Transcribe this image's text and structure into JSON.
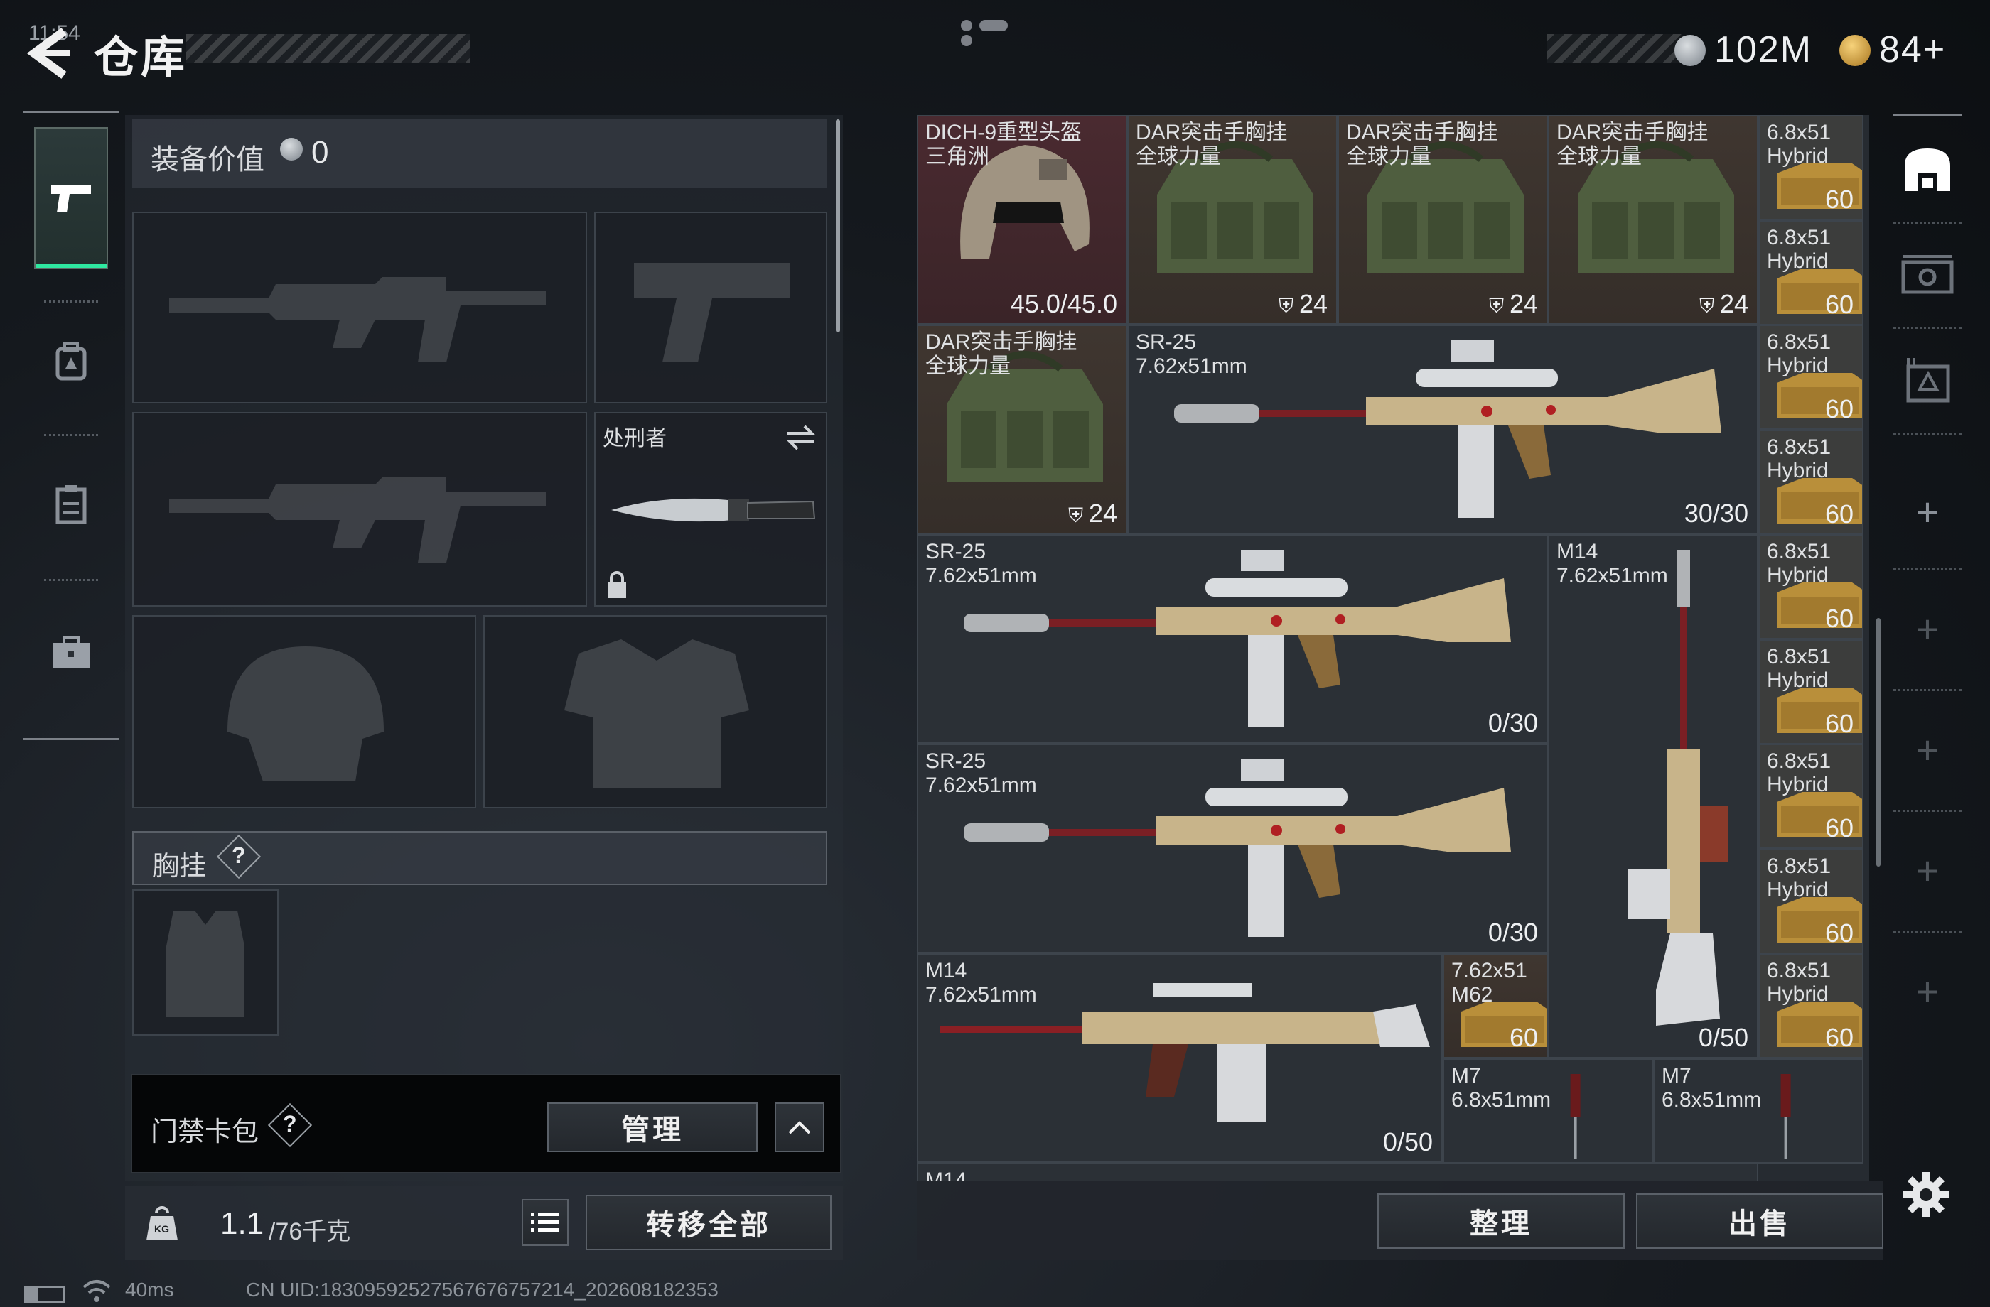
{
  "header": {
    "time": "11:54",
    "title": "仓库",
    "currency_1": {
      "icon": "coin-icon",
      "value": "102M"
    },
    "currency_2": {
      "icon": "medal-icon",
      "value": "84+"
    }
  },
  "left_rail": {
    "items": [
      {
        "icon": "pistol-icon",
        "active": true
      },
      {
        "icon": "backpack-icon",
        "active": false
      },
      {
        "icon": "clipboard-icon",
        "active": false
      },
      {
        "icon": "briefcase-icon",
        "active": false
      }
    ]
  },
  "equipment": {
    "value_label": "装备价值",
    "value": "0",
    "melee_name": "处刑者",
    "chest_label": "胸挂",
    "help": "?",
    "keycard_label": "门禁卡包",
    "manage_label": "管理",
    "weight_current": "1.1",
    "weight_max": "/76千克",
    "transfer_all_label": "转移全部",
    "weight_icon_text": "KG"
  },
  "inventory": {
    "cells": [
      {
        "id": "helmet",
        "name": "DICH-9重型头盔\n三角洲",
        "count": "45.0/45.0",
        "style": "red",
        "art": "helmet"
      },
      {
        "id": "rig1",
        "name": "DAR突击手胸挂\n全球力量",
        "count": "24",
        "style": "brown",
        "art": "rig",
        "count_icon": true
      },
      {
        "id": "rig2",
        "name": "DAR突击手胸挂\n全球力量",
        "count": "24",
        "style": "brown",
        "art": "rig",
        "count_icon": true
      },
      {
        "id": "rig3",
        "name": "DAR突击手胸挂\n全球力量",
        "count": "24",
        "style": "brown",
        "art": "rig",
        "count_icon": true
      },
      {
        "id": "rig4",
        "name": "DAR突击手胸挂\n全球力量",
        "count": "24",
        "style": "brown",
        "art": "rig",
        "count_icon": true
      },
      {
        "id": "sr25a",
        "name": "SR-25\n7.62x51mm",
        "count": "30/30",
        "style": "plain",
        "art": "rifle"
      },
      {
        "id": "sr25b",
        "name": "SR-25\n7.62x51mm",
        "count": "0/30",
        "style": "plain",
        "art": "rifle"
      },
      {
        "id": "sr25c",
        "name": "SR-25\n7.62x51mm",
        "count": "0/30",
        "style": "plain",
        "art": "rifle"
      },
      {
        "id": "m14v",
        "name": "M14\n7.62x51mm",
        "count": "0/50",
        "style": "plain",
        "art": "rifle-v"
      },
      {
        "id": "m14h",
        "name": "M14\n7.62x51mm",
        "count": "0/50",
        "style": "plain",
        "art": "m14"
      },
      {
        "id": "m62",
        "name": "7.62x51\nM62",
        "count": "60",
        "style": "brown",
        "art": "ammo"
      },
      {
        "id": "m7a",
        "name": "M7\n6.8x51mm",
        "count": "",
        "style": "plain",
        "art": "bayonet"
      },
      {
        "id": "m7b",
        "name": "M7\n6.8x51mm",
        "count": "",
        "style": "plain",
        "art": "bayonet"
      },
      {
        "id": "m14bottom",
        "name": "M14",
        "count": "",
        "style": "plain",
        "art": "none"
      }
    ],
    "ammo_name": "6.8x51\nHybrid",
    "ammo_count": "60",
    "sort_label": "整理",
    "sell_label": "出售"
  },
  "status_bar": {
    "ping": "40ms",
    "uid": "CN UID:18309592527567676757214_202608182353"
  }
}
